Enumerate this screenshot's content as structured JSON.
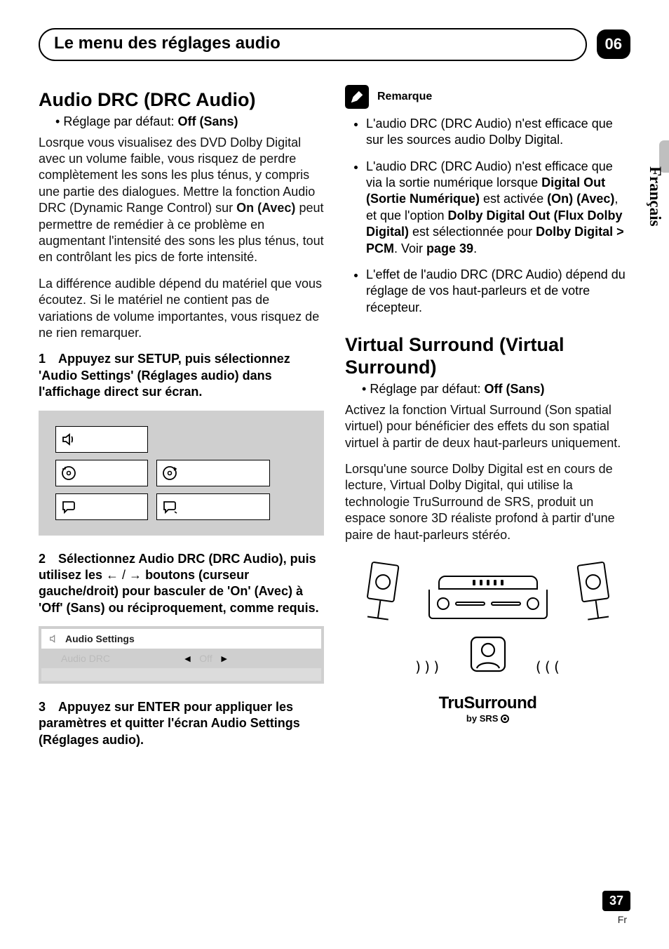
{
  "header": {
    "title": "Le menu des réglages audio",
    "chapter": "06"
  },
  "side_tab": "Français",
  "drc": {
    "heading": "Audio DRC (DRC Audio)",
    "default_label": "Réglage par défaut: ",
    "default_value": "Off (Sans)",
    "p1a": "Losrque vous visualisez des DVD Dolby Digital avec un volume faible, vous risquez de perdre complètement les sons les plus ténus, y compris une partie des dialogues. Mettre la fonction Audio DRC (Dynamic Range Control) sur ",
    "p1b": "On (Avec)",
    "p1c": " peut permettre de remédier à ce problème en augmentant l'intensité des sons les plus ténus, tout en contrôlant les pics de forte intensité.",
    "p2": "La différence audible dépend du matériel que vous écoutez. Si le matériel ne contient pas de variations de volume importantes, vous risquez de ne rien remarquer.",
    "step1": "Appuyez sur SETUP, puis sélectionnez 'Audio Settings' (Réglages audio) dans l'affichage direct sur écran.",
    "step2a": "Sélectionnez Audio DRC (DRC Audio), puis utilisez les ",
    "step2b": " boutons (curseur gauche/droit) pour basculer de 'On' (Avec) à 'Off' (Sans) ou réciproquement, comme requis.",
    "step3": "Appuyez sur ENTER pour appliquer les paramètres et quitter l'écran Audio Settings (Réglages audio)."
  },
  "settings_panel": {
    "current": "Audio Settings",
    "label": "Audio DRC",
    "value": "Off",
    "arrows": {
      "left": "◄",
      "right": "►"
    }
  },
  "note": {
    "title": "Remarque",
    "items": [
      {
        "plain": "L'audio DRC (DRC Audio) n'est efficace que sur les sources audio Dolby Digital."
      },
      {
        "pre": "L'audio DRC (DRC Audio) n'est efficace que via la sortie numérique lorsque ",
        "b1": "Digital Out (Sortie Numérique)",
        "mid1": " est activée ",
        "b2": "(On) (Avec)",
        "mid2": ", et que l'option ",
        "b3": "Dolby Digital Out (Flux Dolby Digital)",
        "mid3": " est sélectionnée pour ",
        "b4": "Dolby Digital > PCM",
        "post1": ". Voir ",
        "b5": "page 39",
        "post2": "."
      },
      {
        "plain": "L'effet de l'audio DRC (DRC Audio) dépend du réglage de vos haut-parleurs et de votre récepteur."
      }
    ]
  },
  "vs": {
    "heading": "Virtual Surround (Virtual Surround)",
    "default_label": "Réglage par défaut: ",
    "default_value": "Off (Sans)",
    "p1": "Activez la fonction Virtual Surround (Son spatial virtuel) pour bénéficier des effets du son spatial virtuel à partir de deux haut-parleurs uniquement.",
    "p2": "Lorsqu'une source Dolby Digital est en cours de lecture, Virtual Dolby Digital, qui utilise la technologie TruSurround de SRS, produit un espace sonore 3D réaliste profond à partir d'une paire de haut-parleurs stéréo."
  },
  "logo": {
    "main": "TruSurround",
    "sub_pre": "by ",
    "sub_brand": "SRS"
  },
  "footer": {
    "page": "37",
    "lang": "Fr"
  },
  "step_numbers": {
    "s1": "1",
    "s2": "2",
    "s3": "3"
  },
  "bullet": "•",
  "step_arrows": "← / →"
}
